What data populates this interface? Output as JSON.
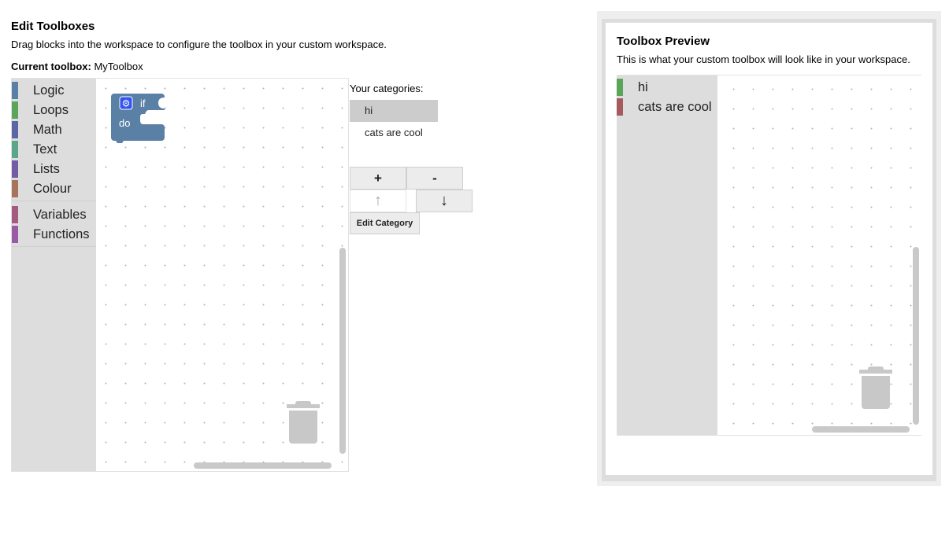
{
  "edit": {
    "title": "Edit Toolboxes",
    "description": "Drag blocks into the workspace to configure the toolbox in your custom workspace.",
    "current_label": "Current toolbox:",
    "current_value": "MyToolbox",
    "toolbox_categories": [
      {
        "label": "Logic",
        "color": "#5b80a5"
      },
      {
        "label": "Loops",
        "color": "#5ba55b"
      },
      {
        "label": "Math",
        "color": "#5b67a5"
      },
      {
        "label": "Text",
        "color": "#5ba58c"
      },
      {
        "label": "Lists",
        "color": "#745ba5"
      },
      {
        "label": "Colour",
        "color": "#a5745b"
      },
      {
        "label": "Variables",
        "color": "#a55b80"
      },
      {
        "label": "Functions",
        "color": "#995ba5"
      }
    ],
    "block": {
      "if_label": "if",
      "do_label": "do",
      "color": "#5b80a5",
      "icon": "gear-icon"
    }
  },
  "categories_panel": {
    "heading": "Your categories:",
    "items": [
      "hi",
      "cats are cool"
    ],
    "selected_index": 0,
    "add_label": "+",
    "remove_label": "-",
    "up_label": "↑",
    "down_label": "↓",
    "edit_label": "Edit Category"
  },
  "preview": {
    "title": "Toolbox Preview",
    "description": "This is what your custom toolbox will look like in your workspace.",
    "categories": [
      {
        "label": "hi",
        "color": "#5ba55b"
      },
      {
        "label": "cats are cool",
        "color": "#a55b5b"
      }
    ]
  }
}
